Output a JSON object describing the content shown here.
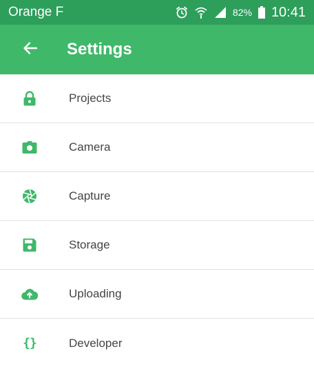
{
  "status_bar": {
    "carrier": "Orange F",
    "battery_percent": "82%",
    "time": "10:41",
    "icons": [
      "alarm-icon",
      "wifi-icon",
      "signal-icon",
      "battery-icon"
    ]
  },
  "app_bar": {
    "back_icon": "arrow-left-icon",
    "title": "Settings"
  },
  "colors": {
    "status_bar": "#2e9e5b",
    "app_bar": "#3fb86a",
    "icon": "#3fb86a",
    "label": "#444444",
    "divider": "#e2e2e2"
  },
  "settings": {
    "items": [
      {
        "label": "Projects",
        "icon": "lock-icon"
      },
      {
        "label": "Camera",
        "icon": "camera-icon"
      },
      {
        "label": "Capture",
        "icon": "shutter-icon"
      },
      {
        "label": "Storage",
        "icon": "floppy-disk-icon"
      },
      {
        "label": "Uploading",
        "icon": "cloud-upload-icon"
      },
      {
        "label": "Developer",
        "icon": "code-braces-icon",
        "glyph": "{}"
      }
    ]
  }
}
